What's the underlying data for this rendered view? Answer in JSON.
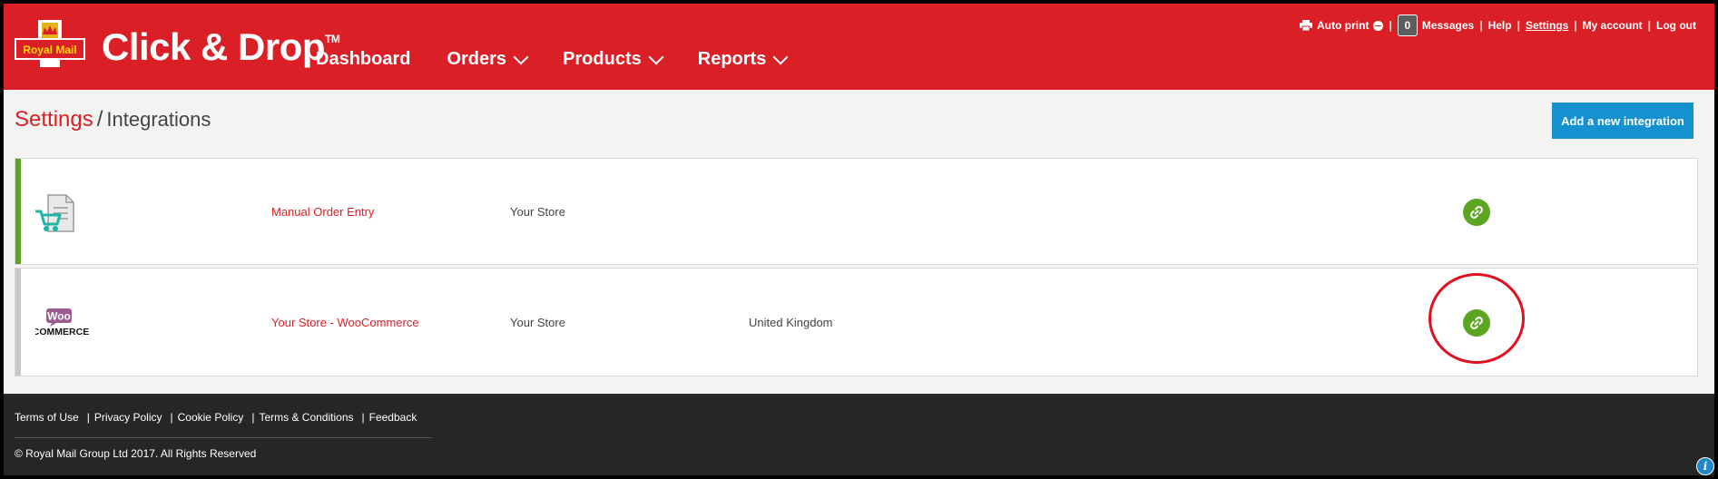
{
  "header": {
    "logo_text": "Royal Mail",
    "brand": "Click & Drop",
    "trademark": "TM",
    "nav": [
      {
        "label": "Dashboard",
        "dropdown": false
      },
      {
        "label": "Orders",
        "dropdown": true
      },
      {
        "label": "Products",
        "dropdown": true
      },
      {
        "label": "Reports",
        "dropdown": true
      }
    ],
    "topbar": {
      "auto_print": "Auto print",
      "messages_count": "0",
      "messages": "Messages",
      "help": "Help",
      "settings": "Settings",
      "my_account": "My account",
      "log_out": "Log out"
    }
  },
  "breadcrumb": {
    "section": "Settings",
    "separator": "/",
    "page": "Integrations"
  },
  "add_button": "Add a new integration",
  "integrations": [
    {
      "icon": "manual-order-entry-icon",
      "name": "Manual Order Entry",
      "store": "Your Store",
      "country": "",
      "accent_color": "#5ba521",
      "action_icon": "link-icon"
    },
    {
      "icon": "woocommerce-logo",
      "logo_text_top": "Woo",
      "logo_text_bottom": "COMMERCE",
      "name": "Your Store - WooCommerce",
      "store": "Your Store",
      "country": "United Kingdom",
      "accent_color": "#c8c8c8",
      "action_icon": "link-icon"
    }
  ],
  "footer": {
    "links": [
      "Terms of Use",
      "Privacy Policy",
      "Cookie Policy",
      "Terms & Conditions",
      "Feedback"
    ],
    "copyright": "© Royal Mail Group Ltd 2017. All Rights Reserved"
  },
  "colors": {
    "brand_red": "#da1f26",
    "button_blue": "#1591d0",
    "link_green": "#5ba521",
    "footer_bg": "#262626"
  }
}
